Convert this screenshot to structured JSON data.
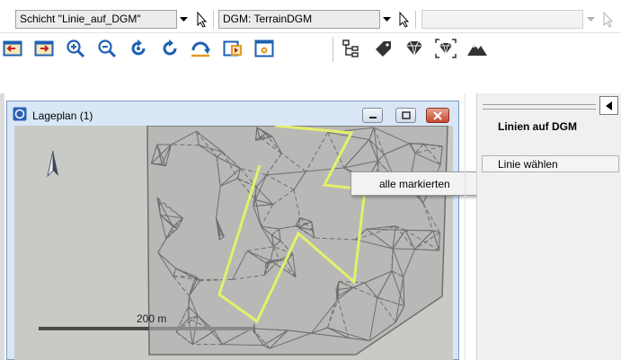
{
  "toolbar_top": {
    "layer_combo": "Schicht \"Linie_auf_DGM\"",
    "dgm_combo": "DGM: TerrainDGM",
    "third_combo": ""
  },
  "toolbar_icons": [
    "zoom-prev-icon",
    "zoom-next-icon",
    "zoom-in-icon",
    "zoom-out-icon",
    "refresh-icon",
    "redraw-icon",
    "undo-icon",
    "export-icon",
    "settings-icon",
    "hierarchy-icon",
    "tag-icon",
    "diamond-icon",
    "diamond-select-icon",
    "terrain-icon"
  ],
  "window": {
    "title": "Lageplan (1)",
    "scale_label": "200 m"
  },
  "context_menu": {
    "item": "alle markierten"
  },
  "panel": {
    "heading": "Linien auf DGM",
    "item": "Linie wählen"
  },
  "colors": {
    "highlight_line": "#e4f06a",
    "mesh": "#6f6f6f",
    "canvas_bg": "#c8cac6",
    "window_frame": "#d9e6f5"
  }
}
